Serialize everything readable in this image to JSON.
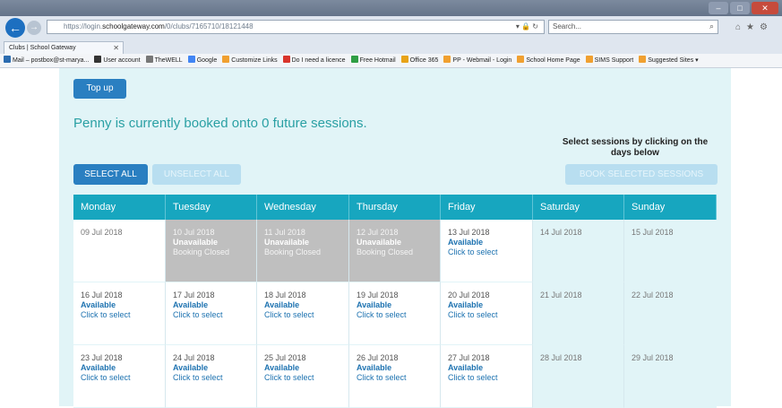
{
  "browser": {
    "url_prefix": "https://login.",
    "url_domain": "schoolgateway.com",
    "url_path": "/0/clubs/7165710/18121448",
    "search_placeholder": "Search...",
    "tab_title": "Clubs | School Gateway",
    "favorites": [
      {
        "label": "Mail – postbox@st-marya...",
        "color": "#2b6cb0"
      },
      {
        "label": "User account",
        "color": "#333333"
      },
      {
        "label": "TheWELL",
        "color": "#777777"
      },
      {
        "label": "Google",
        "color": "#4285f4"
      },
      {
        "label": "Customize Links",
        "color": "#f0a030"
      },
      {
        "label": "Do I need a licence",
        "color": "#d9342b"
      },
      {
        "label": "Free Hotmail",
        "color": "#2f9e44"
      },
      {
        "label": "Office 365",
        "color": "#e8a317"
      },
      {
        "label": "PP - Webmail - Login",
        "color": "#f0a030"
      },
      {
        "label": "School Home Page",
        "color": "#f0a030"
      },
      {
        "label": "SIMS Support",
        "color": "#f0a030"
      },
      {
        "label": "Suggested Sites ▾",
        "color": "#f0a030"
      }
    ]
  },
  "page": {
    "topup_label": "Top up",
    "booked_text": "Penny is currently booked onto 0 future sessions.",
    "instruction": "Select sessions by clicking on the days below",
    "select_all": "SELECT ALL",
    "unselect_all": "UNSELECT ALL",
    "book_selected": "BOOK SELECTED SESSIONS"
  },
  "calendar": {
    "days": [
      "Monday",
      "Tuesday",
      "Wednesday",
      "Thursday",
      "Friday",
      "Saturday",
      "Sunday"
    ],
    "weeks": [
      [
        {
          "date": "09 Jul 2018",
          "kind": "plain"
        },
        {
          "date": "10 Jul 2018",
          "kind": "unavail",
          "status": "Unavailable",
          "sub": "Booking Closed"
        },
        {
          "date": "11 Jul 2018",
          "kind": "unavail",
          "status": "Unavailable",
          "sub": "Booking Closed"
        },
        {
          "date": "12 Jul 2018",
          "kind": "unavail",
          "status": "Unavailable",
          "sub": "Booking Closed"
        },
        {
          "date": "13 Jul 2018",
          "kind": "avail",
          "status": "Available",
          "sub": "Click to select"
        },
        {
          "date": "14 Jul 2018",
          "kind": "weekend"
        },
        {
          "date": "15 Jul 2018",
          "kind": "weekend"
        }
      ],
      [
        {
          "date": "16 Jul 2018",
          "kind": "avail",
          "status": "Available",
          "sub": "Click to select"
        },
        {
          "date": "17 Jul 2018",
          "kind": "avail",
          "status": "Available",
          "sub": "Click to select"
        },
        {
          "date": "18 Jul 2018",
          "kind": "avail",
          "status": "Available",
          "sub": "Click to select"
        },
        {
          "date": "19 Jul 2018",
          "kind": "avail",
          "status": "Available",
          "sub": "Click to select"
        },
        {
          "date": "20 Jul 2018",
          "kind": "avail",
          "status": "Available",
          "sub": "Click to select"
        },
        {
          "date": "21 Jul 2018",
          "kind": "weekend"
        },
        {
          "date": "22 Jul 2018",
          "kind": "weekend"
        }
      ],
      [
        {
          "date": "23 Jul 2018",
          "kind": "avail",
          "status": "Available",
          "sub": "Click to select"
        },
        {
          "date": "24 Jul 2018",
          "kind": "avail",
          "status": "Available",
          "sub": "Click to select"
        },
        {
          "date": "25 Jul 2018",
          "kind": "avail",
          "status": "Available",
          "sub": "Click to select"
        },
        {
          "date": "26 Jul 2018",
          "kind": "avail",
          "status": "Available",
          "sub": "Click to select"
        },
        {
          "date": "27 Jul 2018",
          "kind": "avail",
          "status": "Available",
          "sub": "Click to select"
        },
        {
          "date": "28 Jul 2018",
          "kind": "weekend"
        },
        {
          "date": "29 Jul 2018",
          "kind": "weekend"
        }
      ]
    ]
  }
}
